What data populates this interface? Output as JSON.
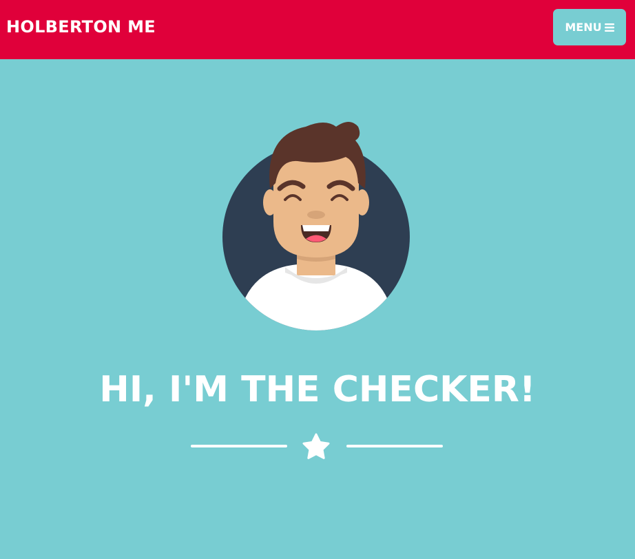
{
  "navbar": {
    "brand": "HOLBERTON ME",
    "menu_label": "MENU",
    "menu_icon": "hamburger-icon",
    "background_color": "#e0003a"
  },
  "hero": {
    "avatar_icon": "smiling-avatar-icon",
    "headline": "HI, I'M THE CHECKER!",
    "divider_icon": "star-icon",
    "background_color": "#78cdd2"
  }
}
